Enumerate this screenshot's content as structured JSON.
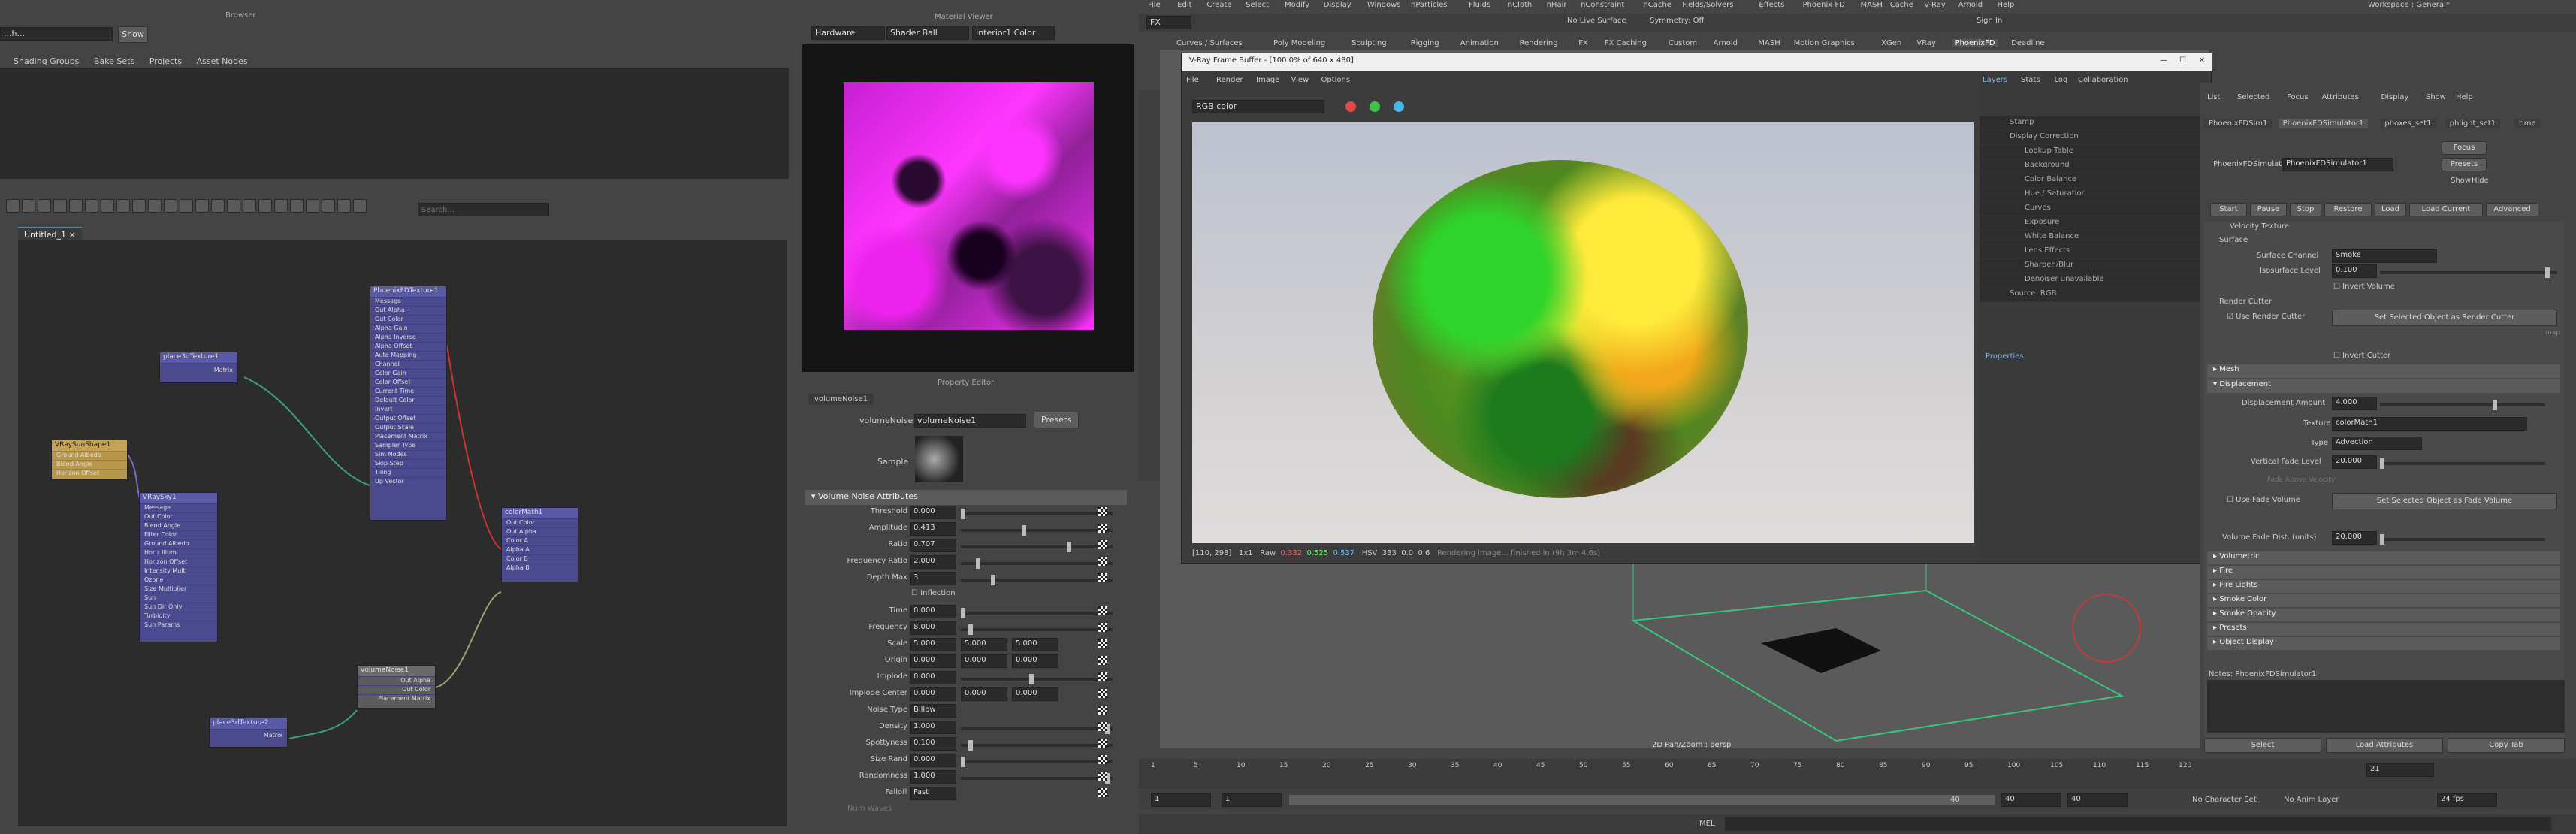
{
  "left_top": {
    "browser_title": "Browser",
    "search_prefix": "...h...",
    "show_btn": "Show",
    "tabs": [
      "Shading Groups",
      "Bake Sets",
      "Projects",
      "Asset Nodes"
    ]
  },
  "hypershade": {
    "search_placeholder": "Search...",
    "tab": "Untitled_1",
    "nodes": {
      "phoenix": {
        "title": "PhoenixFDTexture1",
        "rows": [
          "Message",
          "Out Alpha",
          "Out Color",
          "Alpha Gain",
          "Alpha Inverse",
          "Alpha Offset",
          "Auto Mapping",
          "Channel",
          "Color Gain",
          "Color Offset",
          "Current Time",
          "Default Color",
          "Invert",
          "Output Offset",
          "Output Scale",
          "Placement Matrix",
          "Sampler Type",
          "Sim Nodes",
          "Skip Step",
          "Tiling",
          "Up Vector"
        ]
      },
      "place3d1": {
        "title": "place3dTexture1",
        "rows": [
          "Matrix"
        ]
      },
      "sunshape": {
        "title": "VRaySunShape1",
        "rows": [
          "Ground Albedo",
          "Blend Angle",
          "Horizon Offset"
        ]
      },
      "sky": {
        "title": "VRaySky1",
        "rows": [
          "Message",
          "Out Color",
          "Blend Angle",
          "Filter Color",
          "Ground Albedo",
          "Horiz Illum",
          "Horizon Offset",
          "Intensity Mult",
          "Ozone",
          "Size Multiplier",
          "Sun",
          "Sun Dir Only",
          "Turbidity",
          "Sun Params"
        ]
      },
      "colormath": {
        "title": "colorMath1",
        "rows": [
          "Out Color",
          "Out Alpha",
          "Color A",
          "Alpha A",
          "Color B",
          "Alpha B"
        ]
      },
      "noise": {
        "title": "volumeNoise1",
        "rows": [
          "Out Alpha",
          "Out Color",
          "Placement Matrix"
        ]
      },
      "place3d2": {
        "title": "place3dTexture2",
        "rows": [
          "Matrix"
        ]
      }
    }
  },
  "material_viewer": {
    "title": "Material Viewer",
    "renderer": "Hardware",
    "shader": "Shader Ball",
    "env": "Interior1 Color"
  },
  "property_editor": {
    "title": "Property Editor",
    "tab": "volumeNoise1",
    "node_label": "volumeNoise:",
    "node_value": "volumeNoise1",
    "presets": "Presets",
    "sample_label": "Sample",
    "section": "Volume Noise Attributes",
    "attrs": [
      {
        "label": "Threshold",
        "v": "0.000"
      },
      {
        "label": "Amplitude",
        "v": "0.413"
      },
      {
        "label": "Ratio",
        "v": "0.707"
      },
      {
        "label": "Frequency Ratio",
        "v": "2.000"
      },
      {
        "label": "Depth Max",
        "v": "3"
      }
    ],
    "inflection": "Inflection",
    "attrs2": [
      {
        "label": "Time",
        "v": "0.000"
      },
      {
        "label": "Frequency",
        "v": "8.000"
      }
    ],
    "scale_label": "Scale",
    "scale": [
      "5.000",
      "5.000",
      "5.000"
    ],
    "origin_label": "Origin",
    "origin": [
      "0.000",
      "0.000",
      "0.000"
    ],
    "implode_label": "Implode",
    "implode": "0.000",
    "implode_center_label": "Implode Center",
    "implode_center": [
      "0.000",
      "0.000",
      "0.000"
    ],
    "noise_type_label": "Noise Type",
    "noise_type": "Billow",
    "attrs3": [
      {
        "label": "Density",
        "v": "1.000"
      },
      {
        "label": "Spottyness",
        "v": "0.100"
      },
      {
        "label": "Size Rand",
        "v": "0.000"
      },
      {
        "label": "Randomness",
        "v": "1.000"
      }
    ],
    "falloff_label": "Falloff",
    "falloff": "Fast",
    "num_waves_label": "Num Waves"
  },
  "menubar": {
    "items": [
      "File",
      "Edit",
      "Create",
      "Select",
      "Modify",
      "Display",
      "Windows",
      "nParticles",
      "Fluids",
      "nCloth",
      "nHair",
      "nConstraint",
      "nCache",
      "Fields/Solvers",
      "Effects",
      "Phoenix FD",
      "MASH",
      "Cache",
      "V-Ray",
      "Arnold",
      "Help"
    ],
    "workspace_label": "Workspace :",
    "workspace": "General*"
  },
  "status_line": {
    "mode": "FX",
    "no_live": "No Live Surface",
    "symmetry": "Symmetry: Off",
    "sign_in": "Sign In"
  },
  "shelf_tabs": [
    "Curves / Surfaces",
    "Poly Modeling",
    "Sculpting",
    "Rigging",
    "Animation",
    "Rendering",
    "FX",
    "FX Caching",
    "Custom",
    "Arnold",
    "MASH",
    "Motion Graphics",
    "XGen",
    "VRay",
    "PhoenixFD",
    "Deadline"
  ],
  "vfb": {
    "title": "V-Ray Frame Buffer - [100.0% of 640 x 480]",
    "menu": [
      "File",
      "Render",
      "Image",
      "View",
      "Options"
    ],
    "channel": "RGB color",
    "coords": "[110, 298]",
    "ratio": "1x1",
    "raw": "Raw",
    "vals": [
      "0.332",
      "0.525",
      "0.537"
    ],
    "mode": "HSV",
    "hsv": [
      "333",
      "0.0",
      "0.6"
    ],
    "status": "Rendering image... finished in (9h 3m 4.6s)",
    "side_tabs": [
      "Layers",
      "Stats",
      "Log",
      "Collaboration"
    ],
    "layers": [
      "Stamp",
      "Display Correction",
      "Lookup Table",
      "Background",
      "Color Balance",
      "Hue / Saturation",
      "Curves",
      "Exposure",
      "White Balance",
      "Lens Effects",
      "Sharpen/Blur",
      "Denoiser unavailable",
      "Source: RGB"
    ],
    "properties": "Properties"
  },
  "viewport": {
    "label": "2D Pan/Zoom : persp"
  },
  "attr_editor": {
    "menu": [
      "List",
      "Selected",
      "Focus",
      "Attributes",
      "Display",
      "Show",
      "Help"
    ],
    "tabs": [
      "PhoenixFDSim1",
      "PhoenixFDSimulator1",
      "phoxes_set1",
      "phlight_set1",
      "time"
    ],
    "node_label": "PhoenixFDSimulator:",
    "node_value": "PhoenixFDSimulator1",
    "focus": "Focus",
    "presets": "Presets",
    "show": "Show",
    "hide": "Hide",
    "sim_buttons": [
      "Start",
      "Pause",
      "Stop",
      "Restore",
      "Load",
      "Load Current",
      "Advanced"
    ],
    "velocity": "Velocity Texture",
    "surface_section": "Surface",
    "surface_channel_label": "Surface Channel",
    "surface_channel": "Smoke",
    "isosurface_label": "Isosurface Level",
    "isosurface": "0.100",
    "invert_volume": "Invert Volume",
    "render_cutter": "Render Cutter",
    "use_render_cutter": "Use Render Cutter",
    "set_render_cutter": "Set Selected Object as Render Cutter",
    "invert_cutter": "Invert Cutter",
    "mesh": "Mesh",
    "displacement": "Displacement",
    "disp_amount_label": "Displacement Amount",
    "disp_amount": "4.000",
    "texture_label": "Texture",
    "texture": "colorMath1",
    "type_label": "Type",
    "type": "Advection",
    "vfade_label": "Vertical Fade Level",
    "vfade": "20.000",
    "fade_above": "Fade Above Velocity",
    "use_fade_volume": "Use Fade Volume",
    "set_fade_volume": "Set Selected Object as Fade Volume",
    "vol_fade_label": "Volume Fade Dist. (units)",
    "vol_fade": "20.000",
    "sections": [
      "Volumetric",
      "Fire",
      "Fire Lights",
      "Smoke Color",
      "Smoke Opacity",
      "Presets",
      "Object Display"
    ],
    "notes": "Notes: PhoenixFDSimulator1",
    "bottom_buttons": [
      "Select",
      "Load Attributes",
      "Copy Tab"
    ],
    "map": "map"
  },
  "timeline": {
    "ticks": [
      "1",
      "5",
      "10",
      "15",
      "20",
      "25",
      "30",
      "35",
      "40",
      "45",
      "50",
      "55",
      "60",
      "65",
      "70",
      "75",
      "80",
      "85",
      "90",
      "95",
      "100",
      "105",
      "110",
      "115",
      "120"
    ],
    "current": "21",
    "start": "1",
    "start2": "1",
    "range_end": "40",
    "end1": "40",
    "end2": "40",
    "no_char": "No Character Set",
    "no_anim": "No Anim Layer",
    "fps": "24 fps"
  },
  "cmdline": {
    "label": "MEL"
  },
  "colors": {
    "accent": "#5285a6",
    "magenta": "#ff1aff",
    "wire": "#38c77a"
  }
}
